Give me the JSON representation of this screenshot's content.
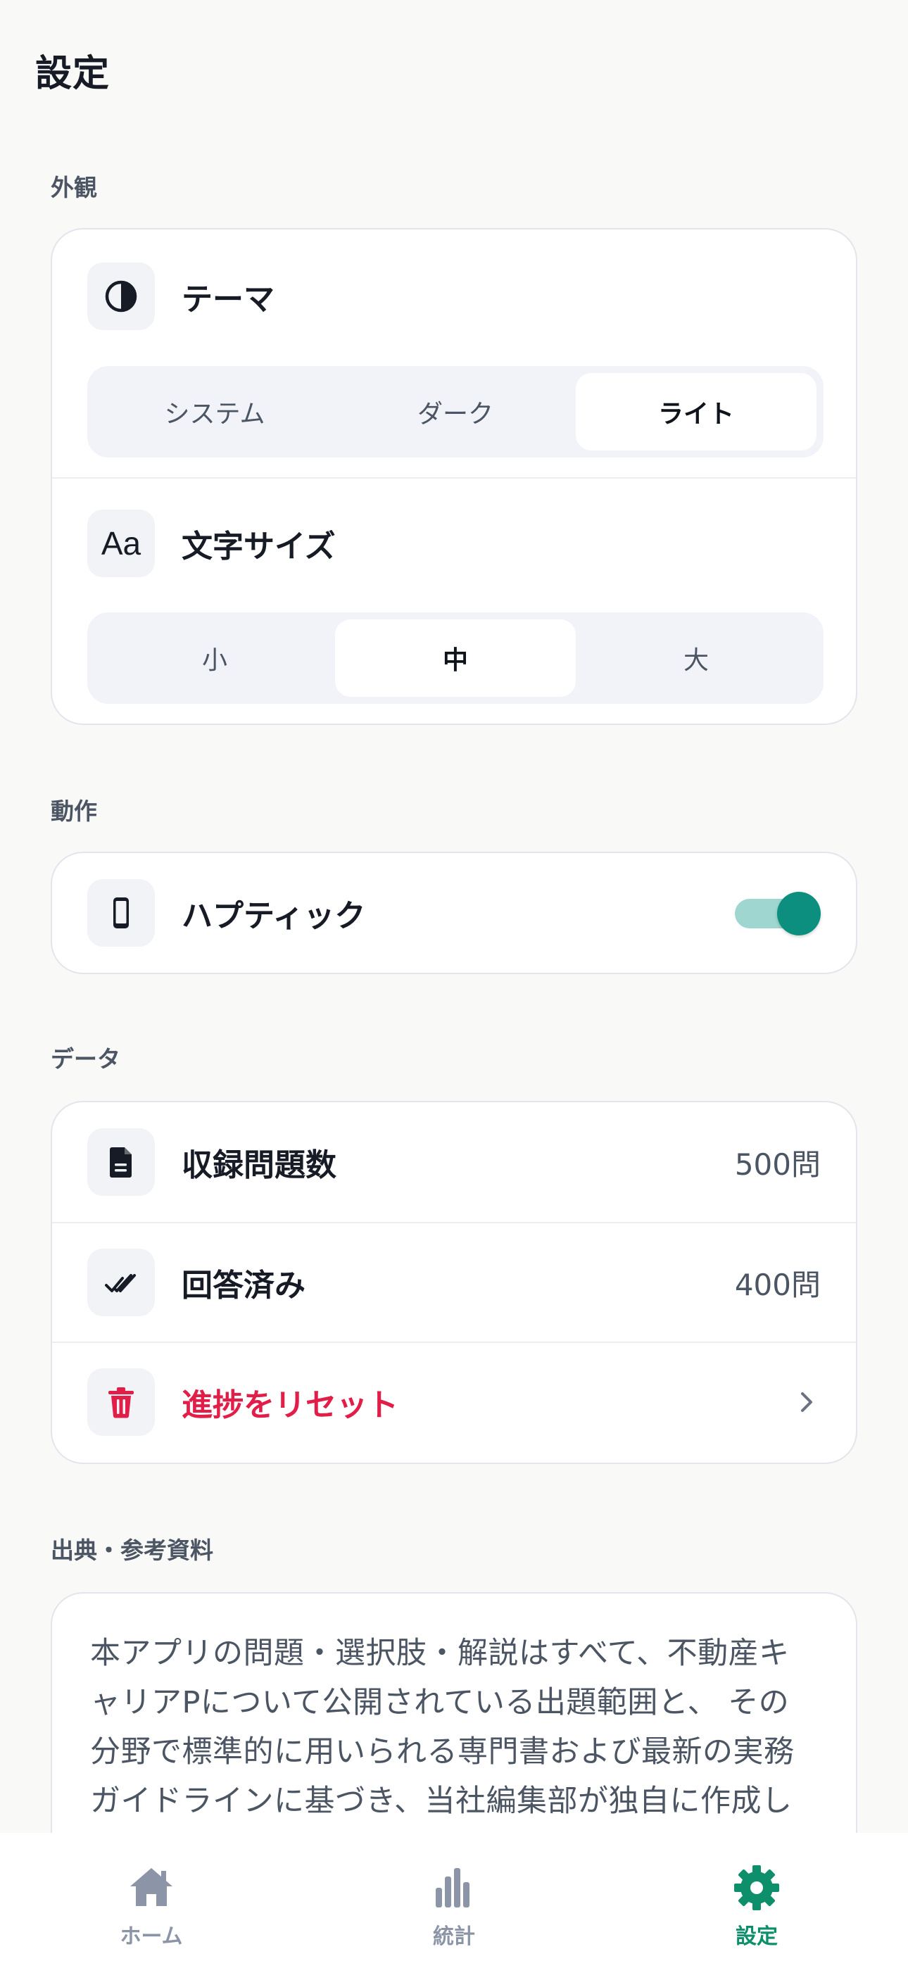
{
  "header": {
    "title": "設定"
  },
  "appearance": {
    "section_label": "外観",
    "theme": {
      "label": "テーマ",
      "icon": "half-circle-icon",
      "options": [
        "システム",
        "ダーク",
        "ライト"
      ],
      "selected": "ライト"
    },
    "font_size": {
      "label": "文字サイズ",
      "icon_text": "Aa",
      "options": [
        "小",
        "中",
        "大"
      ],
      "selected": "中"
    }
  },
  "behavior": {
    "section_label": "動作",
    "haptic": {
      "label": "ハプティック",
      "icon": "phone-icon",
      "enabled": true
    }
  },
  "data": {
    "section_label": "データ",
    "total_questions": {
      "label": "収録問題数",
      "value": "500問",
      "icon": "document-icon"
    },
    "answered": {
      "label": "回答済み",
      "value": "400問",
      "icon": "double-check-icon"
    },
    "reset": {
      "label": "進捗をリセット",
      "icon": "trash-icon"
    }
  },
  "sources": {
    "section_label": "出典・参考資料",
    "text": "本アプリの問題・選択肢・解説はすべて、不動産キャリアPについて公開されている出題範囲と、 その分野で標準的に用いられる専門書および最新の実務ガイドラインに基づき、当社編集部が独自に作成しました。また、試験実施機関の公式問題を転載したものではありません。"
  },
  "tabbar": {
    "tabs": [
      {
        "label": "ホーム",
        "icon": "home-icon"
      },
      {
        "label": "統計",
        "icon": "bar-chart-icon"
      },
      {
        "label": "設定",
        "icon": "gear-icon"
      }
    ],
    "active": "設定"
  },
  "colors": {
    "accent": "#0c8f7f",
    "danger": "#e11d48",
    "background": "#f9f9f8"
  }
}
